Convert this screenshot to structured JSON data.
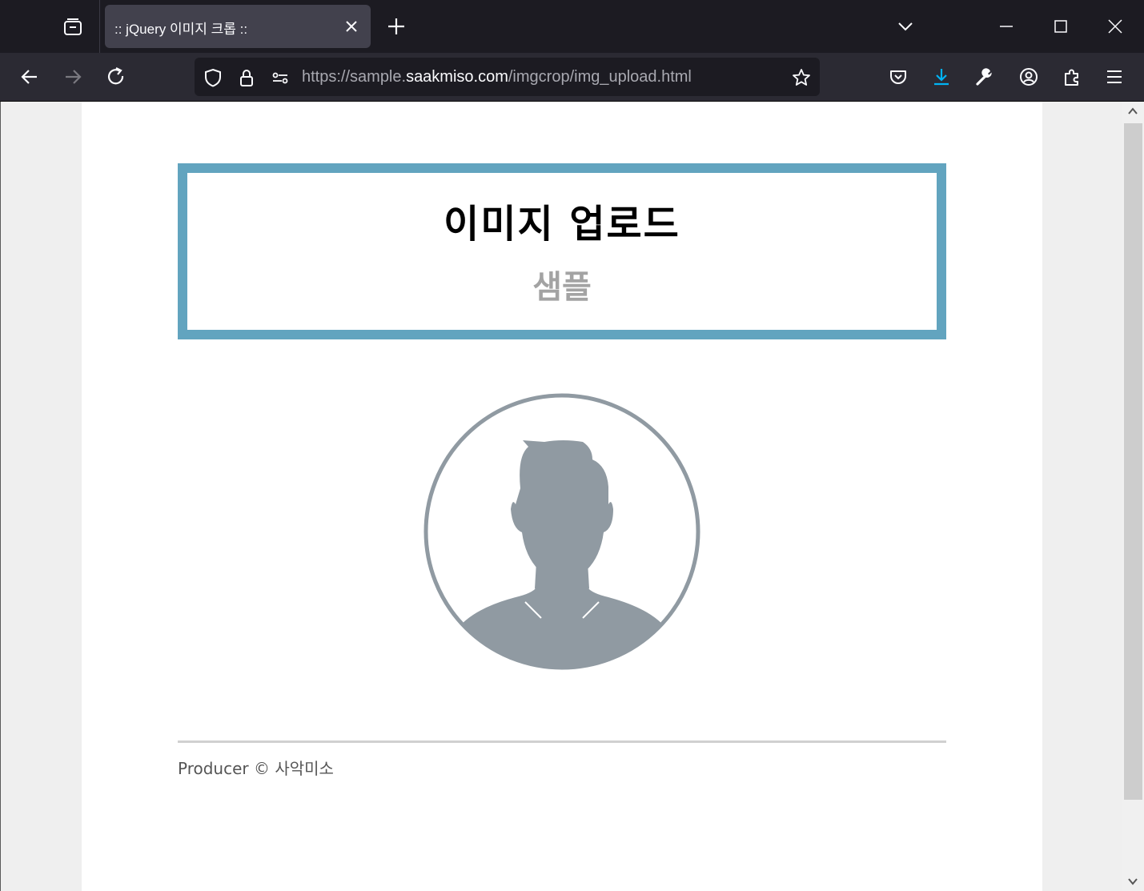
{
  "browser": {
    "tab_title": ":: jQuery 이미지 크롭 ::",
    "url_prefix": "https://sample.",
    "url_host": "saakmiso.com",
    "url_path": "/imgcrop/img_upload.html",
    "download_icon_color": "#00b3f4"
  },
  "page": {
    "title": "이미지 업로드",
    "subtitle": "샘플",
    "accent_color": "#62a4bf",
    "avatar_color": "#909aa2",
    "footer": "Producer © 사악미소"
  }
}
